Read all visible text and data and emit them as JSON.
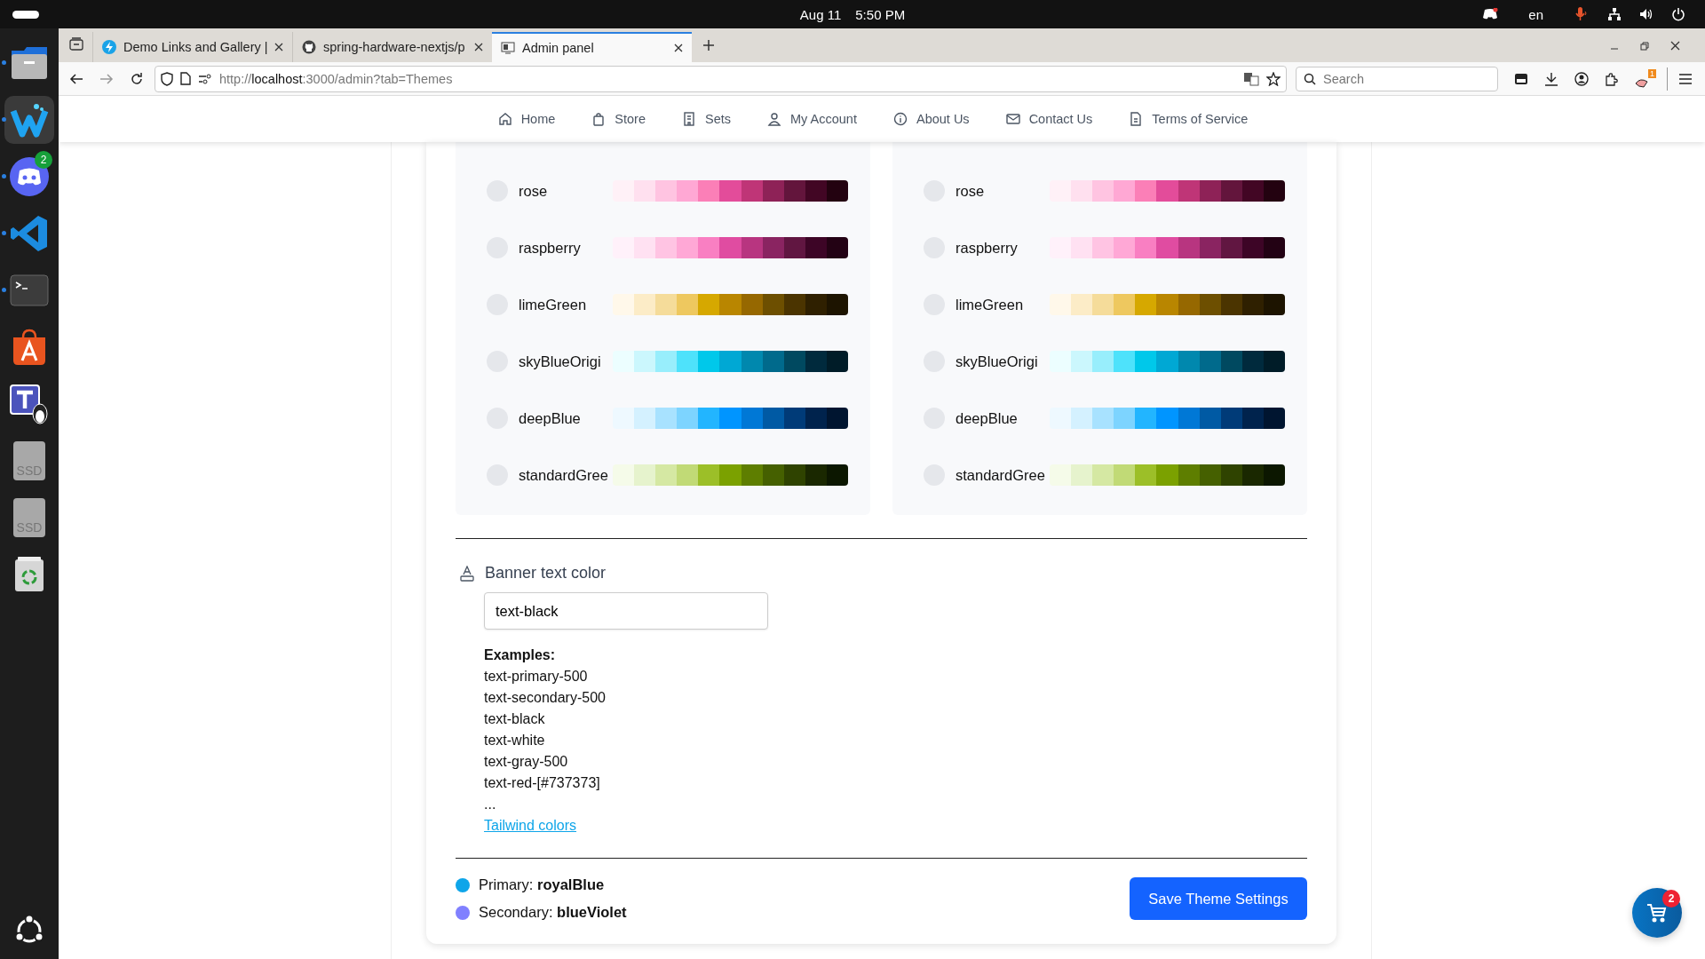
{
  "system_bar": {
    "date": "Aug 11",
    "time": "5:50 PM",
    "language": "en"
  },
  "dock": [
    {
      "kind": "files",
      "running": true,
      "selected": false
    },
    {
      "kind": "writer",
      "running": true,
      "selected": true
    },
    {
      "kind": "chat",
      "running": true,
      "selected": false,
      "badge": "2"
    },
    {
      "kind": "code",
      "running": true,
      "selected": false
    },
    {
      "kind": "terminal",
      "running": true,
      "selected": false
    },
    {
      "kind": "store",
      "running": false,
      "selected": false
    },
    {
      "kind": "teams",
      "running": false,
      "selected": false
    },
    {
      "kind": "drive",
      "running": false,
      "selected": false,
      "label": "SSD"
    },
    {
      "kind": "drive",
      "running": false,
      "selected": false,
      "label": "SSD"
    },
    {
      "kind": "trash",
      "running": false,
      "selected": false
    }
  ],
  "browser": {
    "tabs": [
      {
        "kind": "bolt",
        "title": "Demo Links and Gallery |",
        "selected": false
      },
      {
        "kind": "github",
        "title": "spring-hardware-nextjs/p",
        "selected": false
      },
      {
        "kind": "monitor",
        "title": "Admin panel",
        "selected": true
      }
    ],
    "url": "http://**localhost**:3000/admin?tab=Themes",
    "search": {
      "placeholder": "Search"
    },
    "extension_badge": "1"
  },
  "nav": [
    {
      "kind": "home",
      "label": "Home"
    },
    {
      "kind": "bag",
      "label": "Store"
    },
    {
      "kind": "bookmark",
      "label": "Sets"
    },
    {
      "kind": "user",
      "label": "My Account"
    },
    {
      "kind": "info",
      "label": "About Us"
    },
    {
      "kind": "mail",
      "label": "Contact Us"
    },
    {
      "kind": "doc",
      "label": "Terms of Service"
    }
  ],
  "palettes": [
    {
      "themes": [
        {
          "name": "rose",
          "selected": false,
          "swatches": [
            {
              "color": "#fff1f7"
            },
            {
              "color": "#ffe0ef"
            },
            {
              "color": "#ffc4e1"
            },
            {
              "color": "#ffa8d4"
            },
            {
              "color": "#fb7fb7"
            },
            {
              "color": "#e34c9a"
            },
            {
              "color": "#bf3577"
            },
            {
              "color": "#8e2257"
            },
            {
              "color": "#63153c"
            },
            {
              "color": "#420624"
            },
            {
              "color": "#230210"
            }
          ]
        },
        {
          "name": "raspberry",
          "selected": false,
          "swatches": [
            {
              "color": "#fff1fa"
            },
            {
              "color": "#ffe1f2"
            },
            {
              "color": "#ffc4e3"
            },
            {
              "color": "#ffa8d6"
            },
            {
              "color": "#f97fc2"
            },
            {
              "color": "#e04ca1"
            },
            {
              "color": "#b83580"
            },
            {
              "color": "#8a2461"
            },
            {
              "color": "#611641"
            },
            {
              "color": "#3d0526"
            },
            {
              "color": "#230214"
            }
          ]
        },
        {
          "name": "limeGreen",
          "selected": false,
          "swatches": [
            {
              "color": "#fff8ea"
            },
            {
              "color": "#fcecc7"
            },
            {
              "color": "#f5dc9a"
            },
            {
              "color": "#eec85f"
            },
            {
              "color": "#d6a800"
            },
            {
              "color": "#b98600"
            },
            {
              "color": "#966800"
            },
            {
              "color": "#6d4f00"
            },
            {
              "color": "#4b3400"
            },
            {
              "color": "#2f2000"
            },
            {
              "color": "#1d1400"
            }
          ]
        },
        {
          "name": "skyBlueOrigi",
          "selected": false,
          "swatches": [
            {
              "color": "#ecfeff"
            },
            {
              "color": "#cbf7fd"
            },
            {
              "color": "#98eefc"
            },
            {
              "color": "#4ee2fb"
            },
            {
              "color": "#00c8ea"
            },
            {
              "color": "#00a8d4"
            },
            {
              "color": "#0088ae"
            },
            {
              "color": "#006a8c"
            },
            {
              "color": "#004960"
            },
            {
              "color": "#002a3d"
            },
            {
              "color": "#001c28"
            }
          ]
        },
        {
          "name": "deepBlue",
          "selected": false,
          "swatches": [
            {
              "color": "#eef9ff"
            },
            {
              "color": "#d4f1ff"
            },
            {
              "color": "#a8e2ff"
            },
            {
              "color": "#7dd4ff"
            },
            {
              "color": "#22b5ff"
            },
            {
              "color": "#0095ff"
            },
            {
              "color": "#0078d6"
            },
            {
              "color": "#005aa4"
            },
            {
              "color": "#003b78"
            },
            {
              "color": "#00234d"
            },
            {
              "color": "#001530"
            }
          ]
        },
        {
          "name": "standardGree",
          "selected": false,
          "swatches": [
            {
              "color": "#f5fbe9"
            },
            {
              "color": "#e6f3cd"
            },
            {
              "color": "#d5e8a3"
            },
            {
              "color": "#c1da76"
            },
            {
              "color": "#9cbf28"
            },
            {
              "color": "#7ba100"
            },
            {
              "color": "#5e7e00"
            },
            {
              "color": "#456000"
            },
            {
              "color": "#2f4300"
            },
            {
              "color": "#1a2800"
            },
            {
              "color": "#0c1700"
            }
          ]
        }
      ]
    },
    {
      "themes": [
        {
          "name": "rose",
          "selected": false,
          "swatches": [
            {
              "color": "#fff1f7"
            },
            {
              "color": "#ffe0ef"
            },
            {
              "color": "#ffc4e1"
            },
            {
              "color": "#ffa8d4"
            },
            {
              "color": "#fb7fb7"
            },
            {
              "color": "#e34c9a"
            },
            {
              "color": "#bf3577"
            },
            {
              "color": "#8e2257"
            },
            {
              "color": "#63153c"
            },
            {
              "color": "#420624"
            },
            {
              "color": "#230210"
            }
          ]
        },
        {
          "name": "raspberry",
          "selected": false,
          "swatches": [
            {
              "color": "#fff1fa"
            },
            {
              "color": "#ffe1f2"
            },
            {
              "color": "#ffc4e3"
            },
            {
              "color": "#ffa8d6"
            },
            {
              "color": "#f97fc2"
            },
            {
              "color": "#e04ca1"
            },
            {
              "color": "#b83580"
            },
            {
              "color": "#8a2461"
            },
            {
              "color": "#611641"
            },
            {
              "color": "#3d0526"
            },
            {
              "color": "#230214"
            }
          ]
        },
        {
          "name": "limeGreen",
          "selected": false,
          "swatches": [
            {
              "color": "#fff8ea"
            },
            {
              "color": "#fcecc7"
            },
            {
              "color": "#f5dc9a"
            },
            {
              "color": "#eec85f"
            },
            {
              "color": "#d6a800"
            },
            {
              "color": "#b98600"
            },
            {
              "color": "#966800"
            },
            {
              "color": "#6d4f00"
            },
            {
              "color": "#4b3400"
            },
            {
              "color": "#2f2000"
            },
            {
              "color": "#1d1400"
            }
          ]
        },
        {
          "name": "skyBlueOrigi",
          "selected": false,
          "swatches": [
            {
              "color": "#ecfeff"
            },
            {
              "color": "#cbf7fd"
            },
            {
              "color": "#98eefc"
            },
            {
              "color": "#4ee2fb"
            },
            {
              "color": "#00c8ea"
            },
            {
              "color": "#00a8d4"
            },
            {
              "color": "#0088ae"
            },
            {
              "color": "#006a8c"
            },
            {
              "color": "#004960"
            },
            {
              "color": "#002a3d"
            },
            {
              "color": "#001c28"
            }
          ]
        },
        {
          "name": "deepBlue",
          "selected": false,
          "swatches": [
            {
              "color": "#eef9ff"
            },
            {
              "color": "#d4f1ff"
            },
            {
              "color": "#a8e2ff"
            },
            {
              "color": "#7dd4ff"
            },
            {
              "color": "#22b5ff"
            },
            {
              "color": "#0095ff"
            },
            {
              "color": "#0078d6"
            },
            {
              "color": "#005aa4"
            },
            {
              "color": "#003b78"
            },
            {
              "color": "#00234d"
            },
            {
              "color": "#001530"
            }
          ]
        },
        {
          "name": "standardGree",
          "selected": false,
          "swatches": [
            {
              "color": "#f5fbe9"
            },
            {
              "color": "#e6f3cd"
            },
            {
              "color": "#d5e8a3"
            },
            {
              "color": "#c1da76"
            },
            {
              "color": "#9cbf28"
            },
            {
              "color": "#7ba100"
            },
            {
              "color": "#5e7e00"
            },
            {
              "color": "#456000"
            },
            {
              "color": "#2f4300"
            },
            {
              "color": "#1a2800"
            },
            {
              "color": "#0c1700"
            }
          ]
        }
      ]
    }
  ],
  "banner_text_color": {
    "title": "Banner text color",
    "value": "text-black",
    "examples_heading": "Examples:",
    "examples": [
      "text-primary-500",
      "text-secondary-500",
      "text-black",
      "text-white",
      "text-gray-500",
      "text-red-[#737373]",
      "..."
    ],
    "link": "Tailwind colors"
  },
  "legend": [
    {
      "text": "Primary: **royalBlue**",
      "color": "#0ea5e9"
    },
    {
      "text": "Secondary: **blueViolet**",
      "color": "#8080ff"
    }
  ],
  "save_button": "Save Theme Settings",
  "cart": {
    "count": "2"
  }
}
